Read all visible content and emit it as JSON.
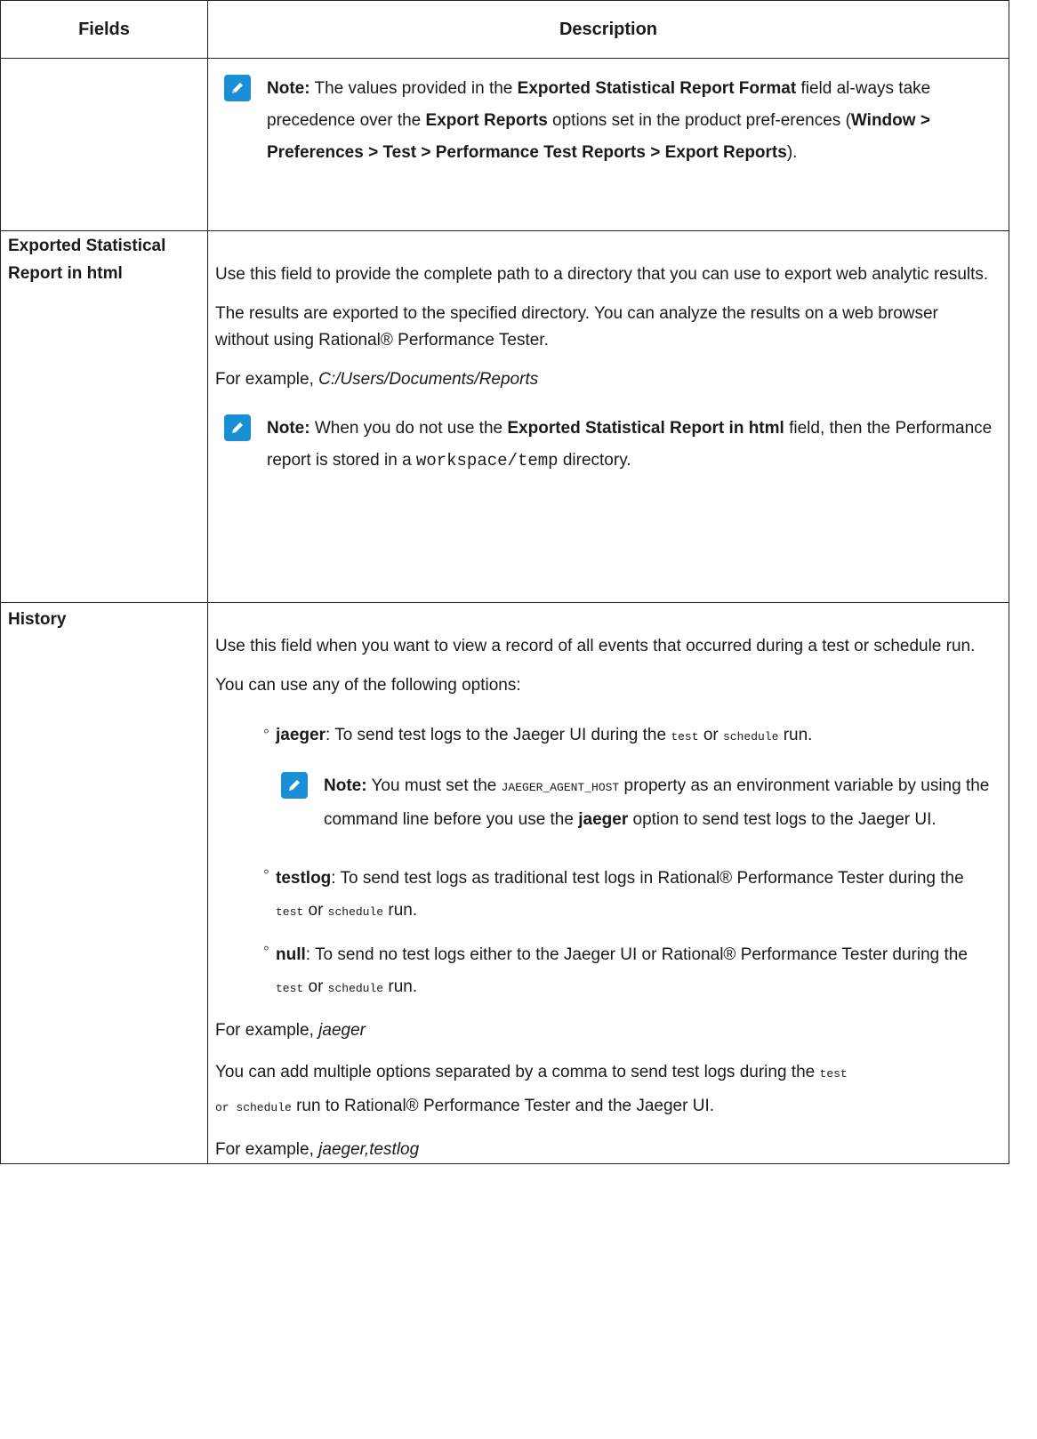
{
  "headers": {
    "fields": "Fields",
    "description": "Description"
  },
  "row1": {
    "note_label": "Note:",
    "t1": " The values provided in the ",
    "b1": "Exported Statistical Report Format",
    "t2": " field al-ways take precedence over the ",
    "b2": "Export Reports",
    "t3": " options set in the product pref-erences (",
    "b3": "Window > Preferences > Test > Performance Test Reports > Export Reports",
    "t4": ")."
  },
  "row2": {
    "field": "Exported Statistical Report in html",
    "p1": "Use this field to provide the complete path to a directory that you can use to export web analytic results.",
    "p2": "The results are exported to the specified directory. You can analyze the results on a web browser without using  Rational® Performance Tester.",
    "ex_prefix": "For example, ",
    "ex_value": "C:/Users/Documents/Reports",
    "note_label": "Note:",
    "n1": " When you do not use the ",
    "n_b": "Exported Statistical Report in html",
    "n2": " field, then the Performance report is stored in a ",
    "n_code": "workspace/temp",
    "n3": " directory."
  },
  "row3": {
    "field": "History",
    "p1": "Use this field when you want to view a record of all events that occurred during a test or schedule run.",
    "p2": "You can use any of the following options:",
    "opt1_name": "jaeger",
    "opt1_text": ": To send test logs to the Jaeger UI during the ",
    "code_test": "test",
    "or": " or ",
    "code_schedule": "schedule",
    "run": " run.",
    "note_label": "Note:",
    "n1": " You must set the ",
    "n_code": "JAEGER_AGENT_HOST",
    "n2": " property as an environment variable by using the command line before you use the ",
    "n_b": "jaeger",
    "n3": " option to send test logs to the Jaeger UI.",
    "opt2_name": "testlog",
    "opt2_text": ": To send test logs as traditional test logs in  Rational® Performance Tester during the ",
    "opt3_name": "null",
    "opt3_text": ": To send no test logs either to the Jaeger UI or  Rational® Performance Tester during the ",
    "ex1_prefix": "For example, ",
    "ex1_value": "jaeger",
    "p3a": "You can add multiple options separated by a comma to send test logs during the ",
    "p3b": " run to  Rational® Performance Tester and the Jaeger UI.",
    "ex2_prefix": "For example, ",
    "ex2_value": "jaeger,testlog"
  }
}
